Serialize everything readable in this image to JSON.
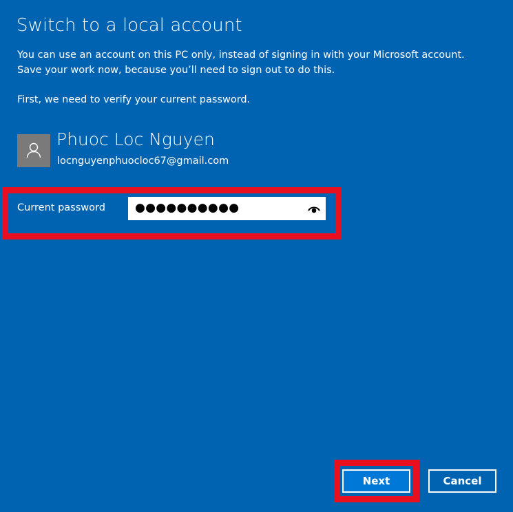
{
  "page": {
    "title": "Switch to a local account",
    "intro_line1": "You can use an account on this PC only, instead of signing in with your Microsoft account.",
    "intro_line2": "Save your work now, because you’ll need to sign out to do this.",
    "verify_text": "First, we need to verify your current password."
  },
  "account": {
    "name": "Phuoc Loc Nguyen",
    "email": "locnguyenphuocloc67@gmail.com",
    "avatar_icon": "person-icon"
  },
  "password": {
    "label": "Current password",
    "value_masked": "●●●●●●●●●●",
    "reveal_icon": "eye-icon"
  },
  "buttons": {
    "next": "Next",
    "cancel": "Cancel"
  },
  "colors": {
    "background": "#0063b1",
    "highlight": "#e8101e",
    "next_button": "#0078d7",
    "avatar_bg": "#7a7a7a"
  }
}
